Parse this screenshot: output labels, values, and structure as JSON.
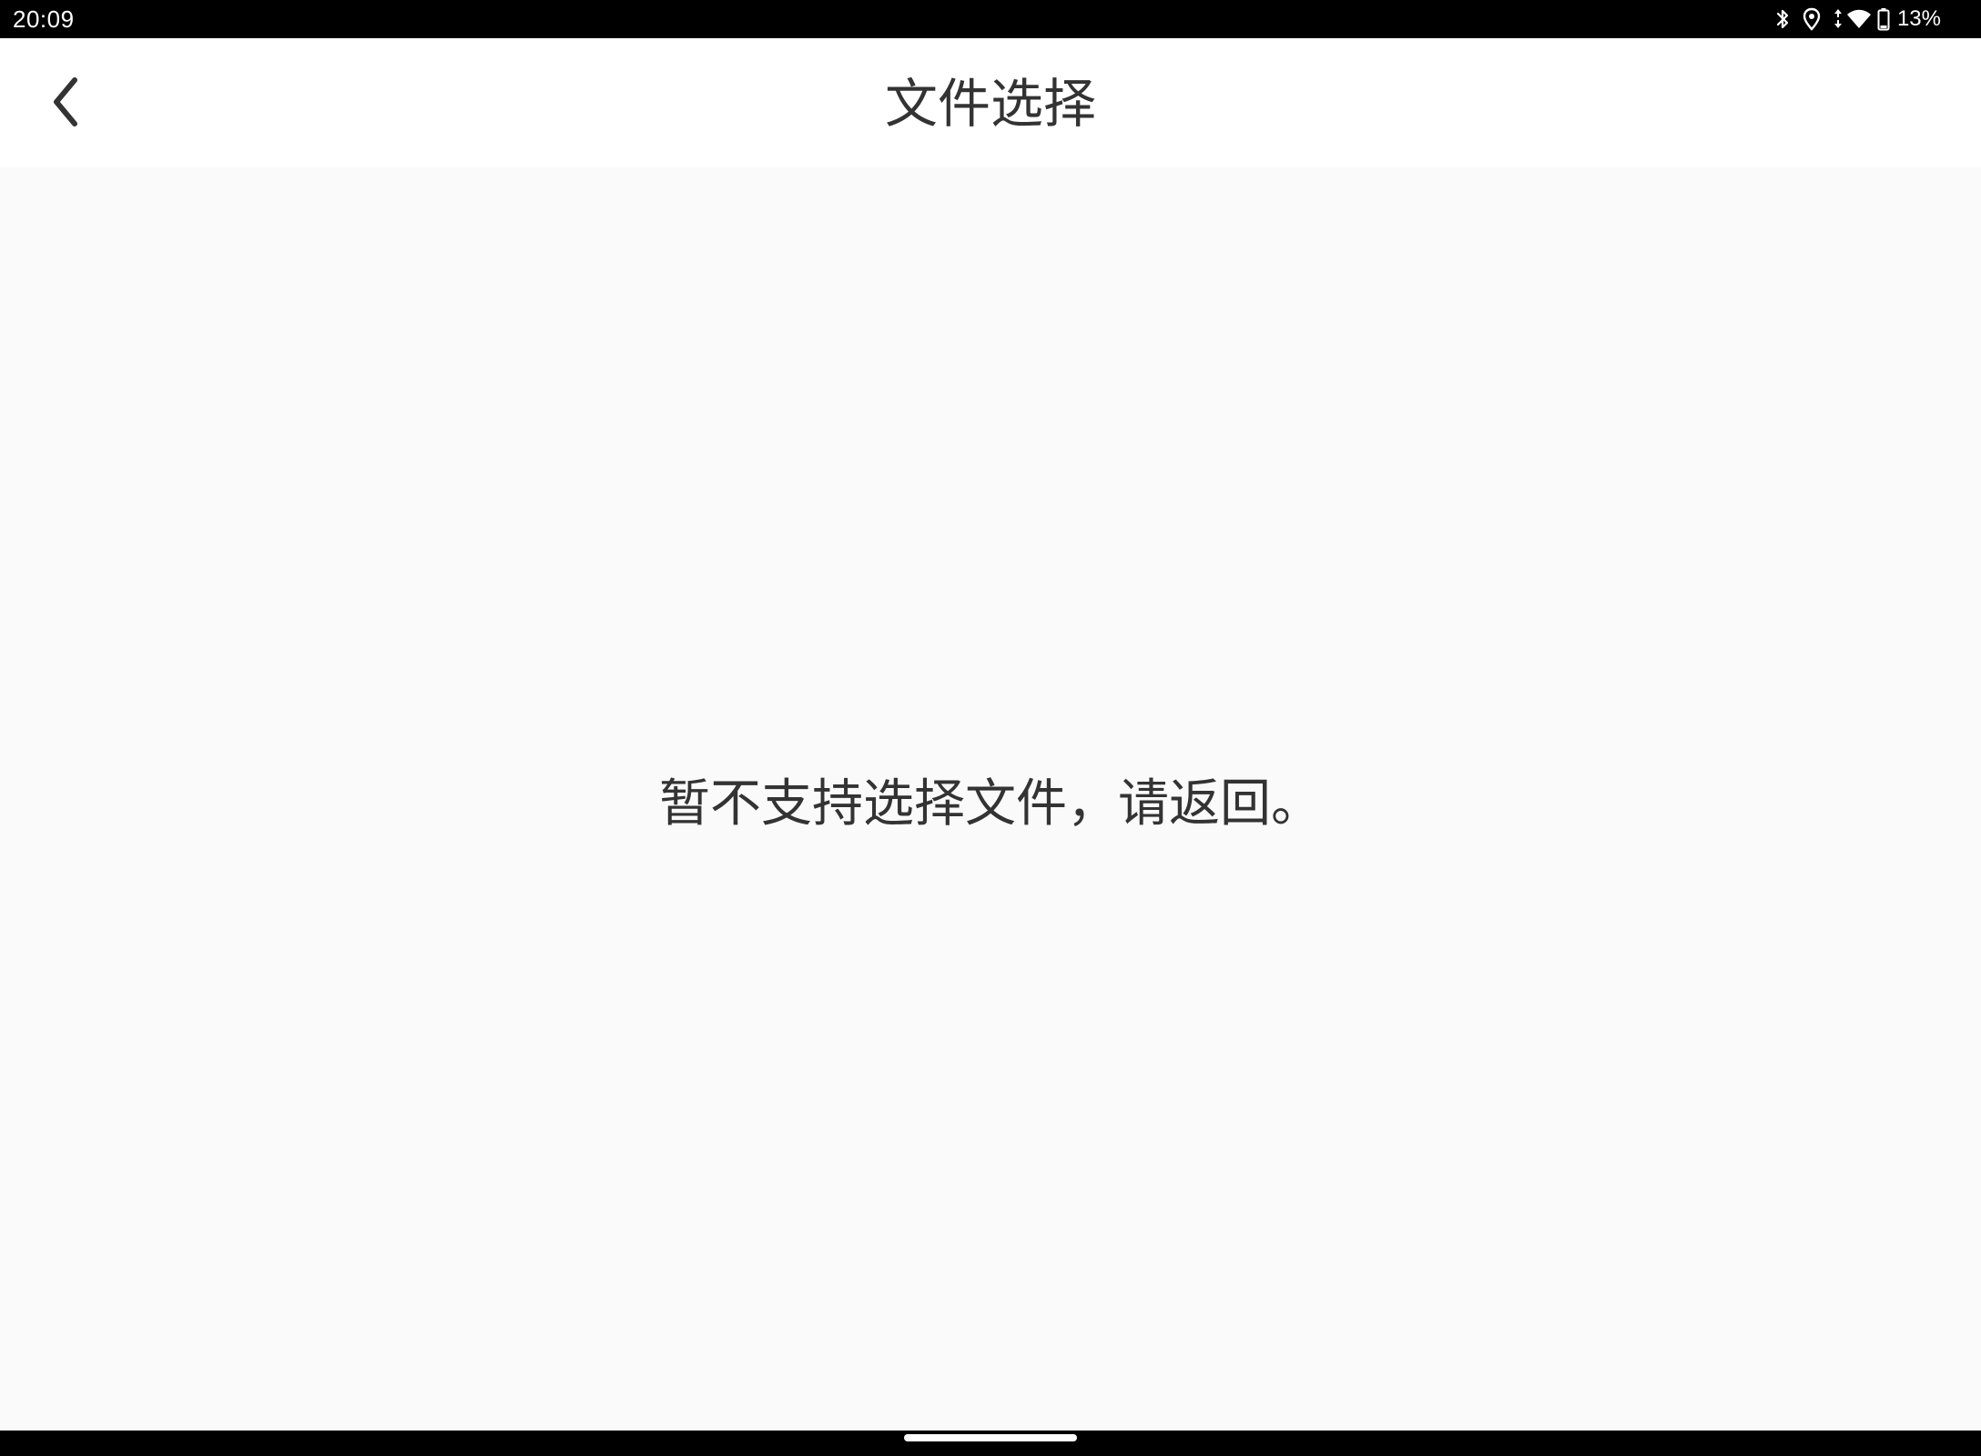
{
  "status_bar": {
    "time": "20:09",
    "battery_percent": "13%",
    "icons": [
      "bluetooth-icon",
      "location-icon",
      "data-arrows-icon",
      "wifi-icon",
      "battery-icon"
    ]
  },
  "app_bar": {
    "title": "文件选择",
    "back_icon": "chevron-left-icon"
  },
  "content": {
    "message": "暂不支持选择文件，请返回。"
  },
  "colors": {
    "status_bar_bg": "#000000",
    "app_bar_bg": "#ffffff",
    "content_bg": "#fafafa",
    "text": "#333333"
  }
}
